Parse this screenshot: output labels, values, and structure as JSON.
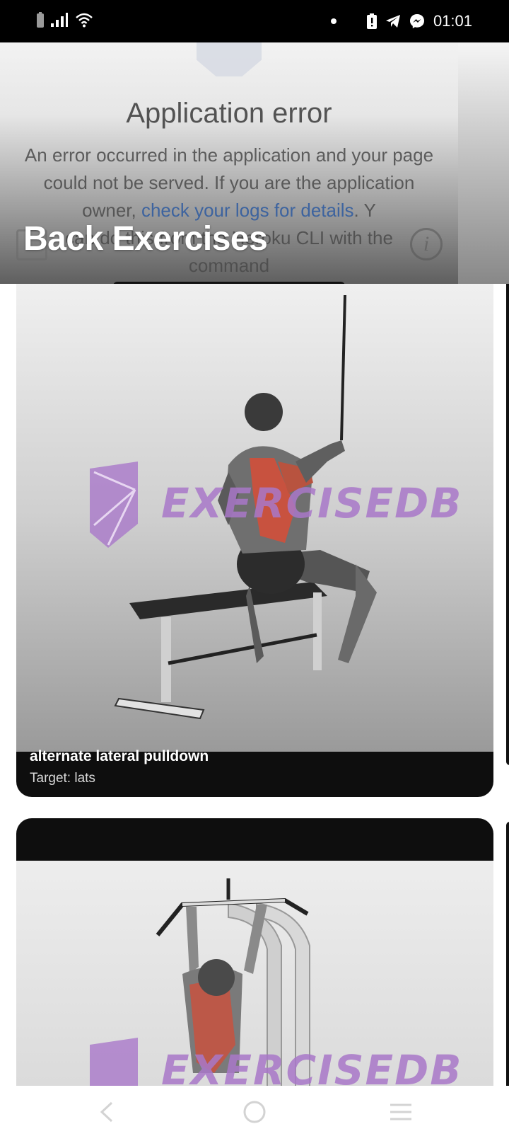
{
  "status_bar": {
    "time": "01:01"
  },
  "webview_error": {
    "title": "Application error",
    "body_before_link": "An error occurred in the application and your page could not be served. If you are the application owner, ",
    "link_text": "check your logs for details",
    "body_after_link": ". Y",
    "body_line4": "can do this from the Heroku CLI with the",
    "body_line5": "command"
  },
  "header": {
    "title": "Back Exercises"
  },
  "exercises": [
    {
      "name": "alternate lateral pulldown",
      "target": "Target: lats",
      "watermark": "EXERCISEDB"
    },
    {
      "name": "",
      "target": "",
      "watermark": "EXERCISEDB"
    }
  ],
  "colors": {
    "status_bar_bg": "#000000",
    "card_bg": "#0e0e0e",
    "watermark": "#a978c9",
    "muscle_highlight": "#c8523f"
  }
}
